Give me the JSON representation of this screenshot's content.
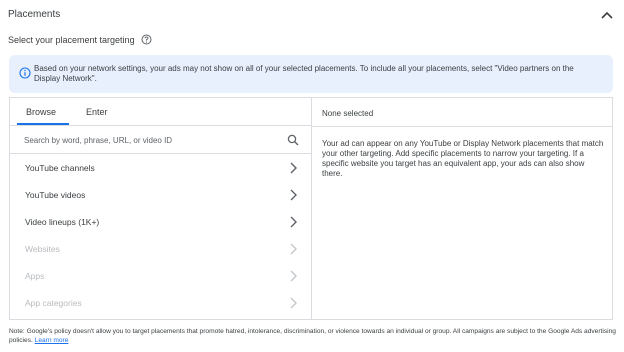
{
  "header": {
    "title": "Placements"
  },
  "subtitle": {
    "text": "Select your placement targeting"
  },
  "banner": {
    "text": "Based on your network settings, your ads may not show on all of your selected placements. To include all your placements, select \"Video partners on the Display Network\"."
  },
  "tabs": [
    {
      "label": "Browse",
      "active": true
    },
    {
      "label": "Enter",
      "active": false
    }
  ],
  "search": {
    "placeholder": "Search by word, phrase, URL, or video ID"
  },
  "categories": [
    {
      "label": "YouTube channels",
      "enabled": true
    },
    {
      "label": "YouTube videos",
      "enabled": true
    },
    {
      "label": "Video lineups (1K+)",
      "enabled": true
    },
    {
      "label": "Websites",
      "enabled": false
    },
    {
      "label": "Apps",
      "enabled": false
    },
    {
      "label": "App categories",
      "enabled": false
    }
  ],
  "selected": {
    "title": "None selected",
    "description": "Your ad can appear on any YouTube or Display Network placements that match your other targeting. Add specific placements to narrow your targeting. If a specific website you target has an equivalent app, your ads can also show there."
  },
  "note": {
    "text": "Note: Google's policy doesn't allow you to target placements that promote hatred, intolerance, discrimination, or violence towards an individual or group. All campaigns are subject to the Google Ads advertising policies.",
    "link": "Learn more"
  },
  "colors": {
    "accent": "#1a73e8",
    "banner_bg": "#e8f0fe",
    "border": "#dadce0",
    "disabled_text": "#b8bbbf"
  },
  "icons": [
    "chevron-up-icon",
    "help-icon",
    "info-icon",
    "search-icon",
    "chevron-right-icon"
  ]
}
